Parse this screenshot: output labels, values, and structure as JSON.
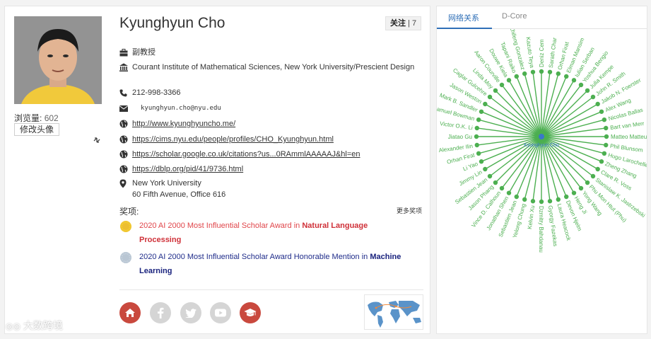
{
  "profile": {
    "name": "Kyunghyun Cho",
    "follow_label": "关注",
    "follow_count": "| 7",
    "views_label": "浏览量:",
    "views_count": "602",
    "avatar_button": "修改头像",
    "title": "副教授",
    "affiliation": "Courant Institute of Mathematical Sciences, New York University/Prescient Design",
    "phone": "212-998-3366",
    "email": "kyunghyun.cho@nyu.edu",
    "links": [
      "http://www.kyunghyuncho.me/",
      "https://cims.nyu.edu/people/profiles/CHO_Kyunghyun.html",
      "https://scholar.google.co.uk/citations?us...0RAmmlAAAAAJ&hl=en",
      "https://dblp.org/pid/41/9736.html"
    ],
    "address_line1": "New York University",
    "address_line2": "60 Fifth Avenue, Office 616"
  },
  "awards": {
    "title": "奖项:",
    "more": "更多奖项",
    "items": [
      {
        "prefix": "2020 AI 2000 Most Influential Scholar Award in ",
        "field": "Natural Language Processing"
      },
      {
        "prefix": "2020 AI 2000 Most Influential Scholar Award Honorable Mention in ",
        "field": "Machine Learning"
      }
    ]
  },
  "network": {
    "tabs": [
      "网络关系",
      "D-Core"
    ],
    "center_label": "Kyunghyun Cho",
    "nodes": [
      "Deniz Cem",
      "Sarath Char",
      "Orhan Firat",
      "Elman Mansim",
      "Iulian Serban",
      "Yoshua Bengio",
      "Julia Kempe",
      "John R. Smith",
      "Jakob N. Foerster",
      "Alex Wang",
      "Nicolas Ballas",
      "Bart van Merr",
      "Matteo Matteucci",
      "Phil Blunsom",
      "Hugo Larochelle",
      "Zheng Zhang",
      "Clare R. Voss",
      "Stanislaw K. Jastrzebski",
      "Phu Mon Htut (Phu)",
      "Yong Wang",
      "Heng Ji",
      "Devon Hjelm",
      "Laura Heacock",
      "Gyorgy Fazekas",
      "Dzmitry Bahdanau",
      "Kelvin Xu",
      "Yelong Chung",
      "Sebastien Jean",
      "Jonathan Shen",
      "Vince D. Calhoun",
      "Jason Phang",
      "Sebastien Jean",
      "Jimmy Lin",
      "Li Yao",
      "Orhan Firat",
      "Alexander Ilin",
      "Jiatao Gu",
      "Victor O.K. Li",
      "Samuel Bowman",
      "Mark B. Sandler",
      "Jason Weston",
      "Caglar Gulcehre",
      "Linda Moy",
      "Aaron Courville",
      "Douwe Kiela",
      "Tapani Raiko",
      "Zhifeng Gonzalez",
      "Kazuto Teya"
    ]
  },
  "icons": {
    "title": "briefcase-icon",
    "affiliation": "institution-icon",
    "phone": "phone-icon",
    "email": "envelope-icon",
    "link": "globe-icon",
    "address": "map-marker-icon",
    "social": [
      "home-icon",
      "facebook-icon",
      "twitter-icon",
      "youtube-icon",
      "graduation-cap-icon"
    ]
  },
  "colors": {
    "accent": "#2f6fb7",
    "award_red": "#e0454a",
    "award_navy": "#1f2c8a",
    "network_green": "#4caf50",
    "social_red": "#c9493e",
    "social_gray": "#d5d5d5"
  },
  "watermark": "大数跨境"
}
